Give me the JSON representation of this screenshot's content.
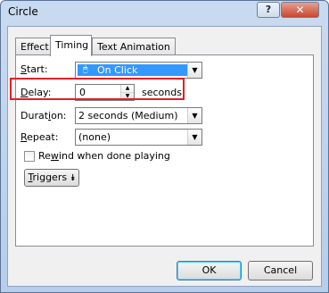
{
  "window": {
    "title": "Circle",
    "help_glyph": "?",
    "close_glyph": "✕"
  },
  "tabs": [
    {
      "label": "Effect"
    },
    {
      "label": "Timing"
    },
    {
      "label": "Text Animation"
    }
  ],
  "start": {
    "label_u": "S",
    "label_rest": "tart:",
    "value": "On Click"
  },
  "delay": {
    "label_u": "D",
    "label_rest": "elay:",
    "value": "0",
    "unit": "seconds"
  },
  "duration": {
    "label_pre": "Durat",
    "label_u": "i",
    "label_rest": "on:",
    "value": "2 seconds (Medium)"
  },
  "repeat": {
    "label_u": "R",
    "label_rest": "epeat:",
    "value": "(none)"
  },
  "rewind": {
    "label_pre": "Re",
    "label_u": "w",
    "label_rest": "ind when done playing",
    "checked": false
  },
  "triggers": {
    "label_u": "T",
    "label_rest": "riggers",
    "glyph": "⯯"
  },
  "footer": {
    "ok_label": "OK",
    "cancel_label": "Cancel"
  },
  "colors": {
    "highlight": "#e0202a",
    "selection": "#3399ff"
  }
}
